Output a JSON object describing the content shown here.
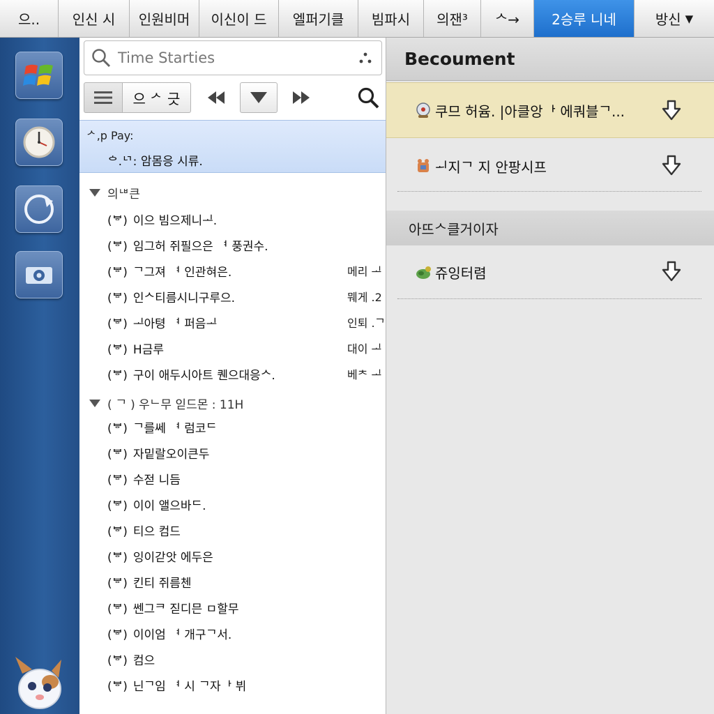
{
  "tabs": [
    {
      "label": "으..",
      "active": false
    },
    {
      "label": "인신 시",
      "active": false
    },
    {
      "label": "인원비머",
      "active": false
    },
    {
      "label": "이신이 드",
      "active": false
    },
    {
      "label": "엘퍼기클",
      "active": false
    },
    {
      "label": "빔파시",
      "active": false
    },
    {
      "label": "의잰³",
      "active": false
    },
    {
      "label": "ᄉ→",
      "active": false
    },
    {
      "label": "2승루 니네",
      "active": true
    },
    {
      "label": "방신",
      "active": false,
      "dropdown": true
    }
  ],
  "dock": {
    "items": [
      {
        "icon": "windows-logo-icon"
      },
      {
        "icon": "clock-icon"
      },
      {
        "icon": "refresh-icon"
      },
      {
        "icon": "gear-icon"
      }
    ],
    "mascot_icon": "mascot-icon"
  },
  "list": {
    "search": {
      "placeholder": "Time Starties"
    },
    "toolbar": {
      "view_label": "으 ᄼ 긋"
    },
    "selected": {
      "line1": "ᄼ,p Pay:",
      "line2": "ᅌ.ᄓ: 암몸응 시류."
    },
    "groups": [
      {
        "header": "의ᄖ큰",
        "rows": [
          {
            "tag": "(ᄫ)",
            "text": "이으 빔으제니ᆚ.",
            "aux": ""
          },
          {
            "tag": "(ᄫ)",
            "text": "임그허 쥐필으은 ᅧ 풍권수.",
            "aux": ""
          },
          {
            "tag": "(ᄫ)",
            "text": "ᄀ그져 ᅧ 인관혀은.",
            "aux": "메리 ᆚ"
          },
          {
            "tag": "(ᄫ)",
            "text": "인ᄉ티름시니구루으.",
            "aux": "뭬게 .2"
          },
          {
            "tag": "(ᄫ)",
            "text": "ᆚ아텽 ᅧ 퍼음ᆚ",
            "aux": "인퇴 .ᄀ"
          },
          {
            "tag": "(ᄫ)",
            "text": "H금루",
            "aux": "대이 ᆚ"
          },
          {
            "tag": "(ᄫ)",
            "text": "구이 애두시아트 퀜으대응ᄉ.",
            "aux": "베ᄎ ᆚ"
          }
        ]
      },
      {
        "header": "( ᄀ ) 우ᄂ무 읻드몬 : 11H",
        "rows": [
          {
            "tag": "(ᄫ)",
            "text": "ᄀ를쎄 ᅧ 럼코ᄃ",
            "aux": ""
          },
          {
            "tag": "(ᄫ)",
            "text": "자밑랄오이큰두",
            "aux": ""
          },
          {
            "tag": "(ᄫ)",
            "text": "수젇 니듬",
            "aux": ""
          },
          {
            "tag": "(ᄫ)",
            "text": "이이 앨으바ᄃ.",
            "aux": ""
          },
          {
            "tag": "(ᄫ)",
            "text": "티으 컴드",
            "aux": ""
          },
          {
            "tag": "(ᄫ)",
            "text": "잉이갇앗 에두은",
            "aux": ""
          },
          {
            "tag": "(ᄫ)",
            "text": "킨티 쥐름첸",
            "aux": ""
          },
          {
            "tag": "(ᄫ)",
            "text": "쎈그ᄏ 짇디믄 ㅁ할무",
            "aux": ""
          },
          {
            "tag": "(ᄫ)",
            "text": "이이엄 ᅧ 개구ᄀ서.",
            "aux": ""
          },
          {
            "tag": "(ᄫ)",
            "text": "컴으",
            "aux": ""
          },
          {
            "tag": "(ᄫ)",
            "text": "닌ᄀ임 ᅧ 시 ᄀ자ᅡ 뷔",
            "aux": ""
          }
        ]
      }
    ]
  },
  "right": {
    "title": "Becoument",
    "items": [
      {
        "icon": "bell-icon",
        "text": "쿠므 허윰. |아클앙ᅡ 에쿼블ᄀ...",
        "highlighted": true
      },
      {
        "icon": "toy-icon",
        "text": "ᅬ지ᄀ 지 안팡시프",
        "highlighted": false
      }
    ],
    "section_title": "아뜨ᄉ클거이자",
    "section_items": [
      {
        "icon": "turtle-icon",
        "text": "쥬잉터렴",
        "highlighted": false
      }
    ],
    "colors": {
      "accent": "#1e6fcc",
      "highlight": "#efe6bd",
      "dock": "#2c5f9d"
    }
  }
}
